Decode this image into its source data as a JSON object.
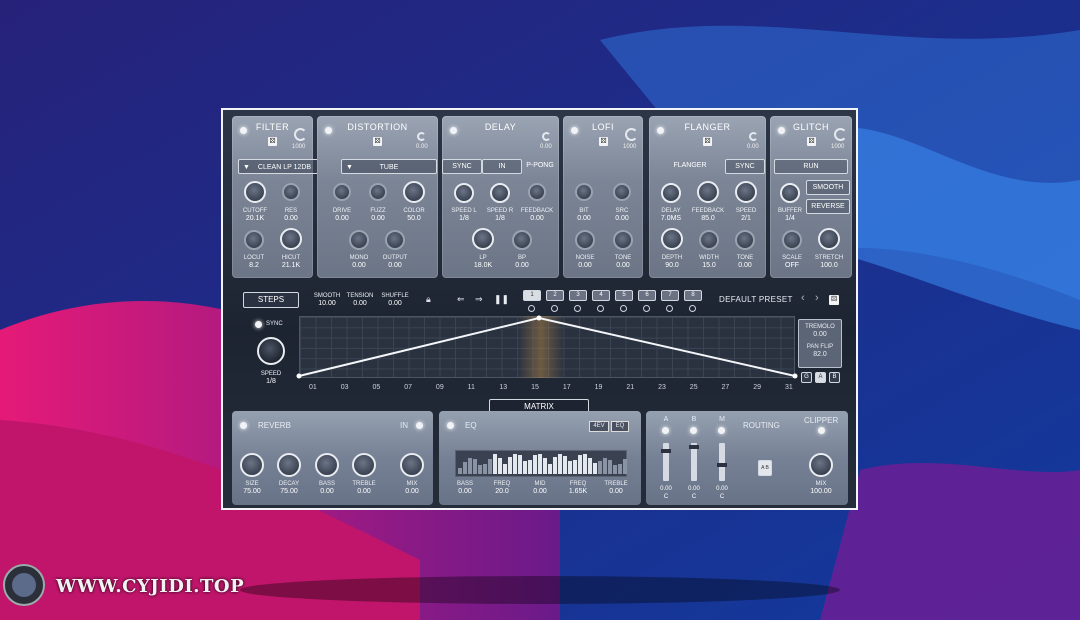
{
  "filter": {
    "title": "FILTER",
    "mini_value": "1000",
    "dropdown": "CLEAN LP 12DB",
    "knobs": [
      {
        "label": "CUTOFF",
        "value": "20.1K"
      },
      {
        "label": "RES",
        "value": "0.00"
      },
      {
        "label": "LOCUT",
        "value": "8.2"
      },
      {
        "label": "HICUT",
        "value": "21.1K"
      }
    ]
  },
  "distortion": {
    "title": "DISTORTION",
    "mini_value": "0.00",
    "dropdown": "TUBE",
    "knobs": [
      {
        "label": "DRIVE",
        "value": "0.00"
      },
      {
        "label": "FUZZ",
        "value": "0.00"
      },
      {
        "label": "COLOR",
        "value": "50.0"
      },
      {
        "label": "MONO",
        "value": "0.00"
      },
      {
        "label": "OUTPUT",
        "value": "0.00"
      }
    ]
  },
  "delay": {
    "title": "DELAY",
    "mini_value": "0.00",
    "buttons": [
      "SYNC",
      "IN",
      "P-PONG"
    ],
    "knobs": [
      {
        "label": "SPEED L",
        "value": "1/8"
      },
      {
        "label": "SPEED R",
        "value": "1/8"
      },
      {
        "label": "FEEDBACK",
        "value": "0.00"
      },
      {
        "label": "LP",
        "value": "18.0K"
      },
      {
        "label": "BP",
        "value": "0.00"
      }
    ]
  },
  "lofi": {
    "title": "LOFI",
    "mini_value": "1000",
    "knobs": [
      {
        "label": "BIT",
        "value": "0.00"
      },
      {
        "label": "SRC",
        "value": "0.00"
      },
      {
        "label": "NOISE",
        "value": "0.00"
      },
      {
        "label": "TONE",
        "value": "0.00"
      }
    ]
  },
  "flanger": {
    "title": "FLANGER",
    "mini_value": "0.00",
    "buttons": [
      "FLANGER",
      "SYNC"
    ],
    "knobs": [
      {
        "label": "DELAY",
        "value": "7.0MS"
      },
      {
        "label": "FEEDBACK",
        "value": "85.0"
      },
      {
        "label": "SPEED",
        "value": "2/1"
      },
      {
        "label": "DEPTH",
        "value": "90.0"
      },
      {
        "label": "WIDTH",
        "value": "15.0"
      },
      {
        "label": "TONE",
        "value": "0.00"
      }
    ]
  },
  "glitch": {
    "title": "GLITCH",
    "mini_value": "1000",
    "buttons": [
      "RUN",
      "SMOOTH",
      "REVERSE"
    ],
    "knobs": [
      {
        "label": "BUFFER",
        "value": "1/4"
      },
      {
        "label": "SCALE",
        "value": "OFF"
      },
      {
        "label": "STRETCH",
        "value": "100.0"
      }
    ]
  },
  "sequencer": {
    "steps_button": "STEPS",
    "params": [
      {
        "label": "SMOOTH",
        "value": "10.00"
      },
      {
        "label": "TENSION",
        "value": "0.00"
      },
      {
        "label": "SHUFFLE",
        "value": "0.00"
      }
    ],
    "pattern_buttons": [
      "1",
      "2",
      "3",
      "4",
      "5",
      "6",
      "7",
      "8"
    ],
    "preset": "DEFAULT PRESET",
    "sync_label": "SYNC",
    "speed_label": "SPEED",
    "speed_value": "1/8",
    "step_labels": [
      "01",
      "03",
      "05",
      "07",
      "09",
      "11",
      "13",
      "15",
      "17",
      "19",
      "21",
      "23",
      "25",
      "27",
      "29",
      "31"
    ],
    "tremolo_label": "TREMOLO",
    "tremolo_value": "0.00",
    "panflip_label": "PAN FLIP",
    "panflip_value": "82.0",
    "target_buttons": [
      "G",
      "A",
      "B"
    ],
    "matrix_button": "MATRIX",
    "envelope_points": [
      {
        "step": 1,
        "level": 0
      },
      {
        "step": 16,
        "level": 1
      },
      {
        "step": 32,
        "level": 0
      }
    ]
  },
  "reverb": {
    "title": "REVERB",
    "toggle": "IN",
    "knobs": [
      {
        "label": "SIZE",
        "value": "75.00"
      },
      {
        "label": "DECAY",
        "value": "75.00"
      },
      {
        "label": "BASS",
        "value": "0.00"
      },
      {
        "label": "TREBLE",
        "value": "0.00"
      },
      {
        "label": "MIX",
        "value": "0.00"
      }
    ]
  },
  "eq": {
    "title": "EQ",
    "tags": [
      "4EV",
      "EQ"
    ],
    "knobs": [
      {
        "label": "BASS",
        "value": "0.00"
      },
      {
        "label": "FREQ",
        "value": "20.0"
      },
      {
        "label": "MID",
        "value": "0.00"
      },
      {
        "label": "FREQ",
        "value": "1.65K"
      },
      {
        "label": "TREBLE",
        "value": "0.00"
      }
    ]
  },
  "routing": {
    "title": "ROUTING",
    "clipper": "CLIPPER",
    "channels": [
      "A",
      "B",
      "M"
    ],
    "fader_values": [
      {
        "value": "0.00",
        "pan": "C"
      },
      {
        "value": "0.00",
        "pan": "C"
      },
      {
        "value": "0.00",
        "pan": "C"
      }
    ],
    "swap": "A B",
    "mix_label": "MIX",
    "mix_value": "100.00"
  },
  "watermark": "WWW.CYJIDI.TOP",
  "colors": {
    "accent": "#f2f4f7",
    "panel": "#7b8596",
    "bg_blue": "#1b1d6b",
    "bg_pink": "#e2187a"
  }
}
